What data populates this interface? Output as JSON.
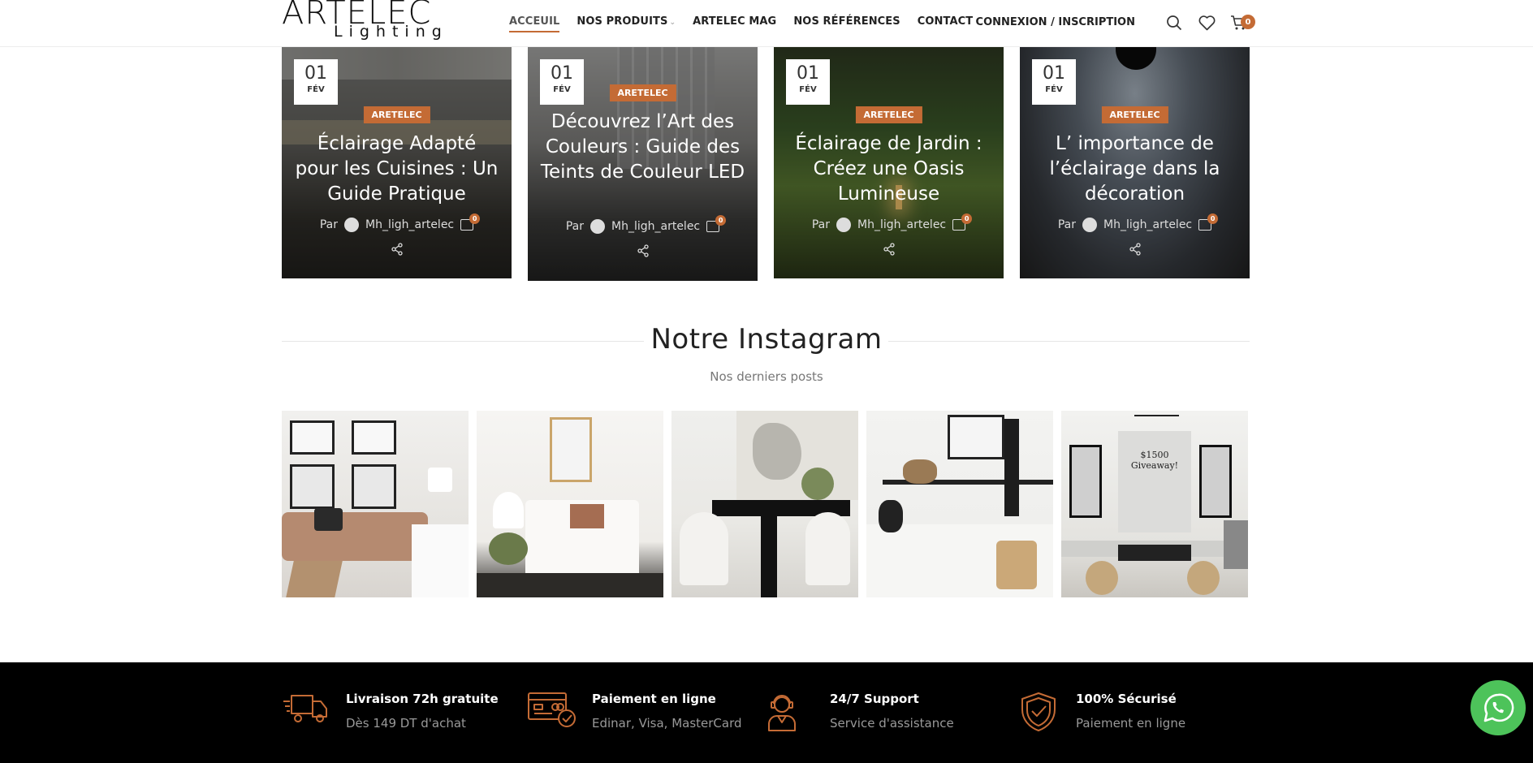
{
  "header": {
    "logo_top": "ARTELEC",
    "logo_bottom": "Lighting",
    "nav": [
      {
        "label": "ACCEUIL"
      },
      {
        "label": "NOS PRODUITS"
      },
      {
        "label": "ARTELEC MAG"
      },
      {
        "label": "NOS RÉFÉRENCES"
      },
      {
        "label": "CONTACT"
      }
    ],
    "login_label": "CONNEXION / INSCRIPTION",
    "cart_count": "0",
    "icons": [
      "search-icon",
      "heart-icon",
      "cart-icon"
    ]
  },
  "posts": [
    {
      "day": "01",
      "month": "FÉV",
      "tag": "ARETELEC",
      "title": "Éclairage Adapté pour les Cuisines : Un Guide Pratique",
      "by": "Par",
      "author": "Mh_ligh_artelec",
      "comments": "0"
    },
    {
      "day": "01",
      "month": "FÉV",
      "tag": "ARETELEC",
      "title": "Découvrez l’Art des Couleurs : Guide des Teints de Couleur LED",
      "by": "Par",
      "author": "Mh_ligh_artelec",
      "comments": "0"
    },
    {
      "day": "01",
      "month": "FÉV",
      "tag": "ARETELEC",
      "title": "Éclairage de Jardin : Créez une Oasis Lumineuse",
      "by": "Par",
      "author": "Mh_ligh_artelec",
      "comments": "0"
    },
    {
      "day": "01",
      "month": "FÉV",
      "tag": "ARETELEC",
      "title": "L’ importance de l’éclairage dans la décoration",
      "by": "Par",
      "author": "Mh_ligh_artelec",
      "comments": "0"
    }
  ],
  "instagram": {
    "title": "Notre Instagram",
    "subtitle": "Nos derniers posts",
    "giveaway_text": "$1500 Giveaway!"
  },
  "footer": {
    "features": [
      {
        "title": "Livraison 72h gratuite",
        "subtitle": "Dès 149 DT d'achat",
        "icon": "truck-icon"
      },
      {
        "title": "Paiement en ligne",
        "subtitle": "Edinar, Visa, MasterCard",
        "icon": "card-icon"
      },
      {
        "title": "24/7 Support",
        "subtitle": "Service d'assistance",
        "icon": "support-icon"
      },
      {
        "title": "100% Sécurisé",
        "subtitle": "Paiement en ligne",
        "icon": "shield-icon"
      }
    ]
  },
  "colors": {
    "accent": "#c46b35",
    "whatsapp": "#4dc35a",
    "footer_bg": "#000000"
  }
}
